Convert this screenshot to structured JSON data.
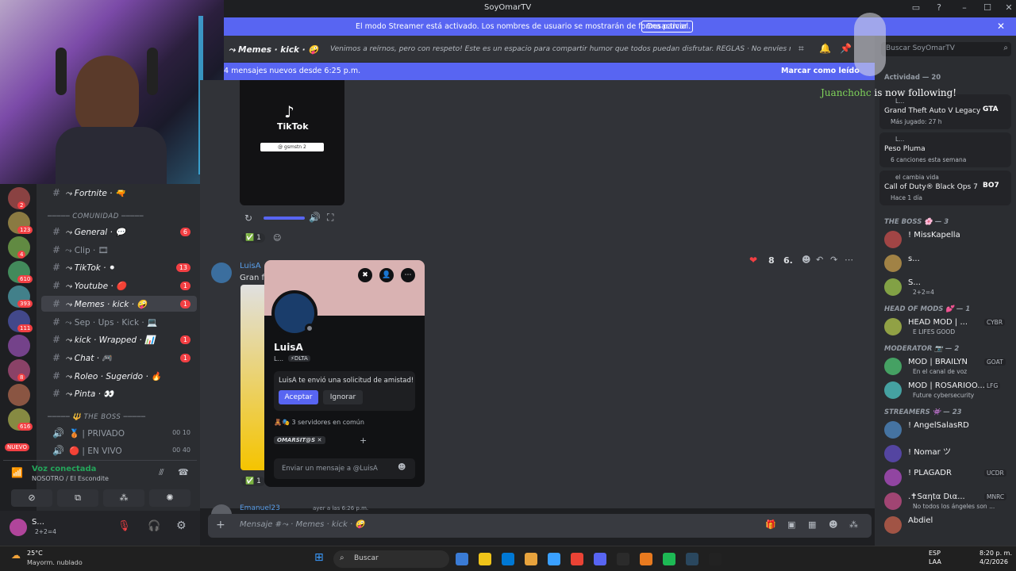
{
  "window": {
    "title": "SoyOmarTV"
  },
  "banner": {
    "message": "El modo Streamer está activado. Los nombres de usuario se mostrarán de forma parcial.",
    "button": "Desactivar"
  },
  "channel": {
    "name": "⤳ Memes · kick · 🤪",
    "topic": "Venimos a reírnos, pero con respeto! Este es un espacio para compartir humor que todos puedan disfrutar. REGLAS  · No envíes memes que c...",
    "search_placeholder": "Buscar SoyOmarTV"
  },
  "newbar": {
    "text": "4 mensajes nuevos desde 6:25 p.m.",
    "action": "Marcar como leído"
  },
  "guilds": [
    {
      "badge": "2"
    },
    {
      "badge": "123"
    },
    {
      "badge": "4"
    },
    {
      "badge": "610"
    },
    {
      "badge": "393"
    },
    {
      "badge": "111"
    },
    {
      "badge": ""
    },
    {
      "badge": "8"
    },
    {
      "badge": ""
    },
    {
      "badge": "616"
    }
  ],
  "guild_new": "NUEVO",
  "channels": {
    "top": {
      "label": "⤳ Fortnite · 🔫"
    },
    "cat1": "COMUNIDAD",
    "list": [
      {
        "label": "⤳ General · 💬",
        "badge": "6",
        "state": "unread"
      },
      {
        "label": "⤳ Clip · 🎞",
        "badge": "",
        "state": "muted"
      },
      {
        "label": "⤳ TikTok · ⚫",
        "badge": "13",
        "state": "unread"
      },
      {
        "label": "⤳ Youtube · 🔴",
        "badge": "1",
        "state": "unread"
      },
      {
        "label": "⤳ Memes · kick · 🤪",
        "badge": "1",
        "state": "active"
      },
      {
        "label": "⤳ Sep · Ups · Kick · 💻",
        "badge": "",
        "state": "muted"
      },
      {
        "label": "⤳ kick · Wrapped · 📊",
        "badge": "1",
        "state": "unread"
      },
      {
        "label": "⤳ Chat · 🎮",
        "badge": "1",
        "state": "unread"
      },
      {
        "label": "⤳ Roleo · Sugerido · 🔥",
        "badge": "",
        "state": "unread"
      },
      {
        "label": "⤳ Pinta · 👀",
        "badge": "",
        "state": "unread"
      }
    ],
    "cat2": "🔱 THE BOSS",
    "voice": [
      {
        "label": "🥉 | PRIVADO",
        "a": "00",
        "b": "10"
      },
      {
        "label": "🔴 | EN VIVO",
        "a": "00",
        "b": "40"
      }
    ]
  },
  "voice_panel": {
    "status": "Voz conectada",
    "where": "NOSOTRO / El Escondite"
  },
  "user_panel": {
    "name": "S...",
    "status": "2+2=4"
  },
  "messages": {
    "tiktok_label": "TikTok",
    "tiktok_search": "@ gsmstn 2",
    "reaction_check": "1",
    "author_cut": "LuisA",
    "text_cut": "Gran fo",
    "reactions_right": {
      "heart": "8",
      "six": "6."
    },
    "reaction_bottom": "1",
    "next_author": "Emanuel23",
    "next_time": "ayer a las 6:26 p.m."
  },
  "popup": {
    "name": "LuisA",
    "sub": "L...",
    "tag": "DLTA",
    "request": "LuisA te envió una solicitud de amistad!",
    "request_bold": "LuisA",
    "accept": "Aceptar",
    "ignore": "Ignorar",
    "mutual": "3 servidores en común",
    "server_tag": "OMARSIT@S",
    "dm_placeholder": "Enviar un mensaje a @LuisA"
  },
  "composer": {
    "placeholder": "Mensaje #⤳ · Memes · kick · 🤪"
  },
  "overlay": {
    "follower": "Juanchohc",
    "follow_text": "is now following!"
  },
  "members": {
    "activity_header": "Actividad — 20",
    "cards": [
      {
        "user": "L...",
        "title": "Grand Theft Auto V Legacy",
        "sub": "Más jugado: 27 h",
        "logo": "GTA"
      },
      {
        "user": "L...",
        "title": "Peso Pluma",
        "sub": "6 canciones esta semana",
        "logo": ""
      },
      {
        "user": "el cambia vida",
        "title": "Call of Duty® Black Ops 7",
        "sub": "Hace 1 día",
        "logo": "BO7"
      }
    ],
    "groups": [
      {
        "header": "THE BOSS 🌸 — 3",
        "items": [
          {
            "name": "! MissKapella",
            "sub": "",
            "tag": ""
          },
          {
            "name": "s...",
            "sub": "",
            "tag": ""
          },
          {
            "name": "S...",
            "sub": "2+2=4",
            "tag": ""
          }
        ]
      },
      {
        "header": "HEAD OF MODS 💕 — 1",
        "items": [
          {
            "name": "HEAD MOD | ...",
            "sub": "E LIFES GOOD",
            "tag": "CYBR"
          }
        ]
      },
      {
        "header": "MODERATOR 📷 — 2",
        "items": [
          {
            "name": "MOD | BRAILYN",
            "sub": "En el canal de voz",
            "tag": "GOAT"
          },
          {
            "name": "MOD | ROSARIOO...",
            "sub": "Future cybersecurity",
            "tag": "LFG"
          }
        ]
      },
      {
        "header": "STREAMERS 👾 — 23",
        "items": [
          {
            "name": "! AngelSalasRD",
            "sub": "",
            "tag": ""
          },
          {
            "name": "! Nomar ツ",
            "sub": "",
            "tag": ""
          },
          {
            "name": "! PLAGADR",
            "sub": "",
            "tag": "UCDR"
          },
          {
            "name": ".✝Sαηtα Dια...",
            "sub": "No todos los ángeles son ...",
            "tag": "MNRC"
          },
          {
            "name": "Abdiel",
            "sub": "",
            "tag": ""
          }
        ]
      }
    ]
  },
  "taskbar": {
    "weather_temp": "25°C",
    "weather_desc": "Mayorm. nublado",
    "search": "Buscar",
    "lang": "ESP",
    "lang2": "LAA",
    "time": "8:20 p. m.",
    "date": "4/2/2026"
  }
}
